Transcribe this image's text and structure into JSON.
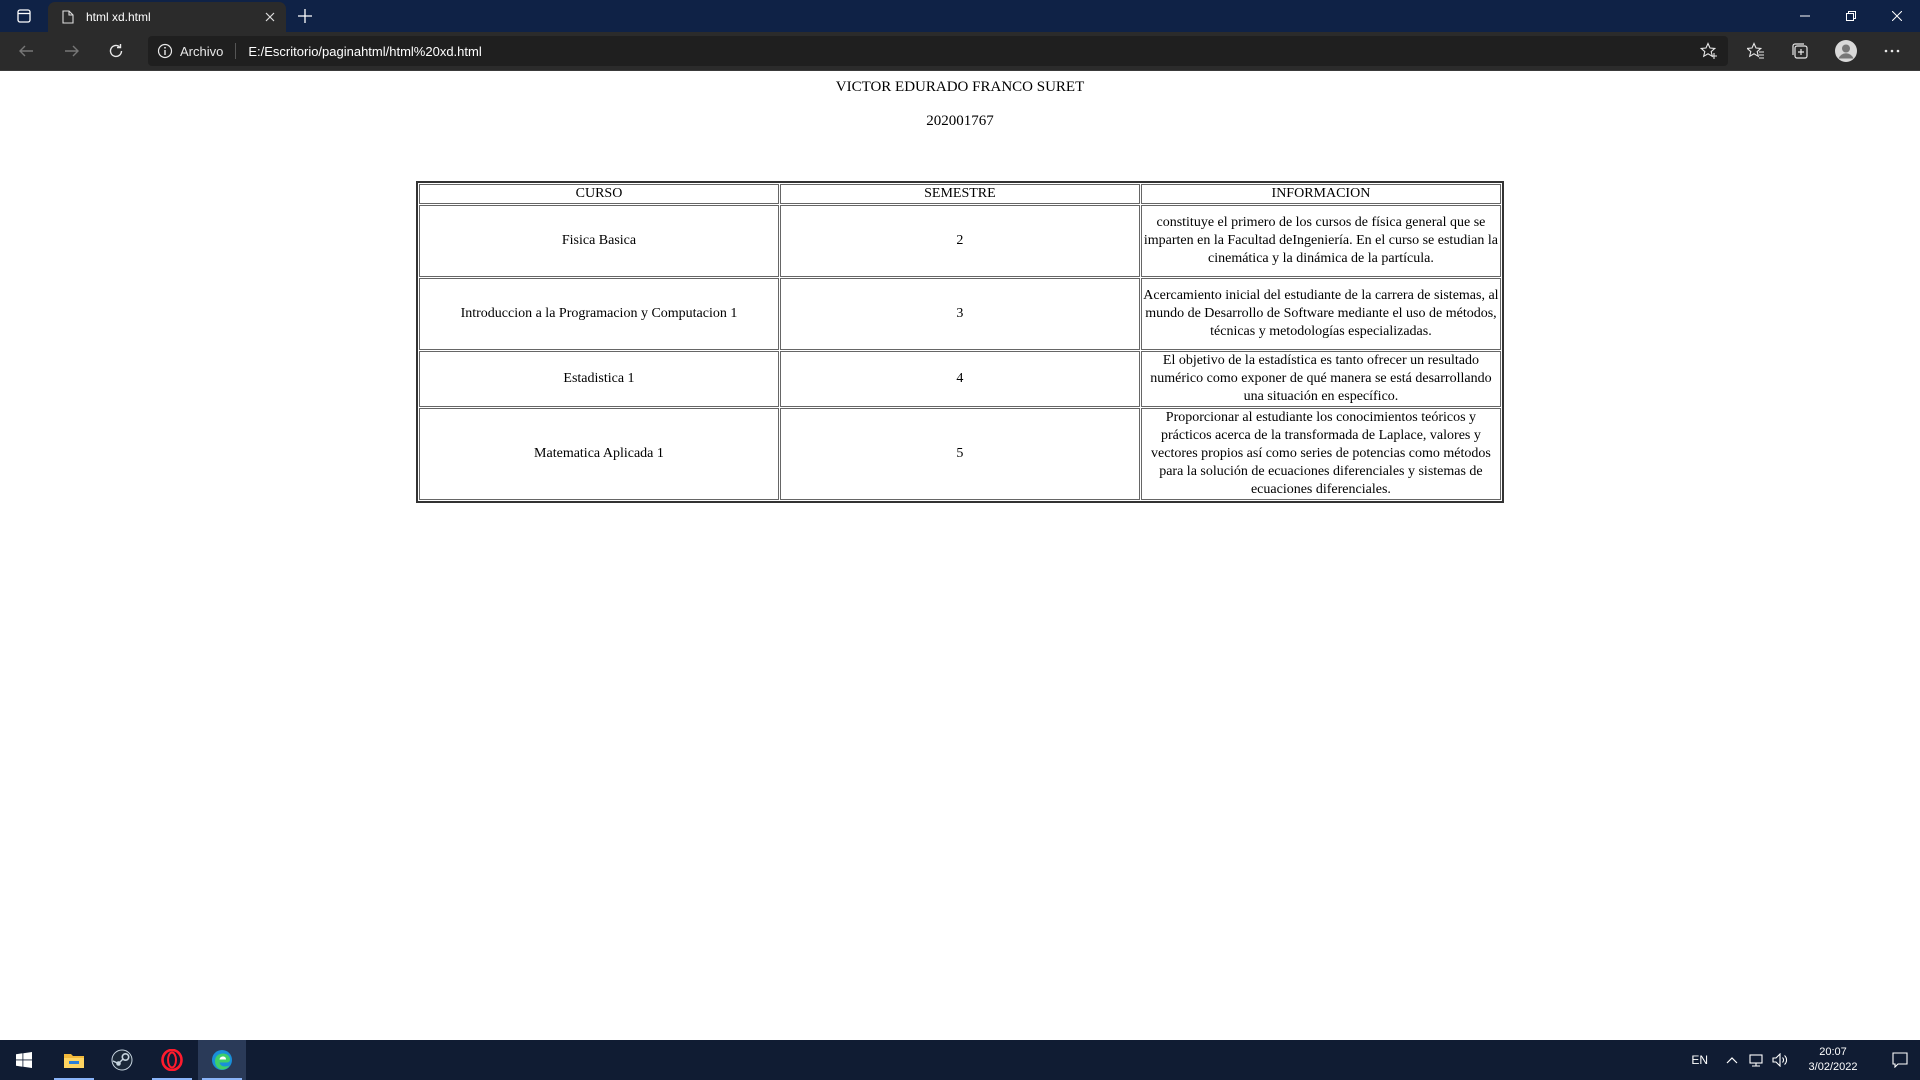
{
  "browser": {
    "tab_title": "html xd.html",
    "site_label": "Archivo",
    "url": "E:/Escritorio/paginahtml/html%20xd.html",
    "window_controls": [
      "minimize",
      "restore",
      "close"
    ]
  },
  "page": {
    "name": "VICTOR EDURADO FRANCO SURET",
    "id_number": "202001767",
    "table": {
      "headers": [
        "CURSO",
        "SEMESTRE",
        "INFORMACION"
      ],
      "rows": [
        {
          "curso": "Fisica Basica",
          "semestre": "2",
          "informacion": "constituye el primero de los cursos de física general que se imparten en la Facultad deIngeniería. En el curso se estudian la cinemática y la dinámica de la partícula."
        },
        {
          "curso": "Introduccion a la Programacion y Computacion 1",
          "semestre": "3",
          "informacion": "Acercamiento inicial del estudiante de la carrera de sistemas, al mundo de Desarrollo de Software mediante el uso de métodos, técnicas y metodologías especializadas."
        },
        {
          "curso": "Estadistica 1",
          "semestre": "4",
          "informacion": "El objetivo de la estadística es tanto ofrecer un resultado numérico como exponer de qué manera se está desarrollando una situación en específico."
        },
        {
          "curso": "Matematica Aplicada 1",
          "semestre": "5",
          "informacion": "Proporcionar al estudiante los conocimientos teóricos y prácticos acerca de la transformada de Laplace, valores y vectores propios así como series de potencias como métodos para la solución de ecuaciones diferenciales y sistemas de ecuaciones diferenciales."
        }
      ]
    }
  },
  "taskbar": {
    "apps": [
      "start-icon",
      "file-explorer-icon",
      "steam-icon",
      "opera-icon",
      "edge-icon"
    ],
    "language": "EN",
    "time": "20:07",
    "date": "3/02/2022"
  }
}
